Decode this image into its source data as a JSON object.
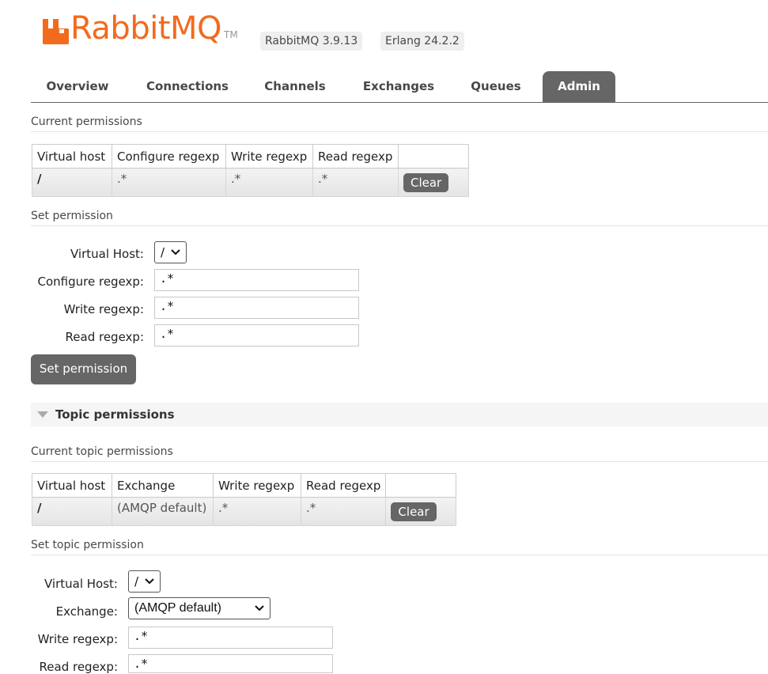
{
  "header": {
    "logo_text": "RabbitMQ",
    "logo_tm": "TM",
    "rabbitmq_version": "RabbitMQ 3.9.13",
    "erlang_version": "Erlang 24.2.2",
    "brand_color": "#f26b1d"
  },
  "tabs": [
    {
      "label": "Overview"
    },
    {
      "label": "Connections"
    },
    {
      "label": "Channels"
    },
    {
      "label": "Exchanges"
    },
    {
      "label": "Queues"
    },
    {
      "label": "Admin",
      "active": true
    }
  ],
  "current_permissions": {
    "title": "Current permissions",
    "columns": [
      "Virtual host",
      "Configure regexp",
      "Write regexp",
      "Read regexp"
    ],
    "rows": [
      {
        "vhost": "/",
        "configure": ".*",
        "write": ".*",
        "read": ".*",
        "action": "Clear"
      }
    ]
  },
  "set_permission": {
    "title": "Set permission",
    "vhost_label": "Virtual Host:",
    "vhost_value": "/",
    "configure_label": "Configure regexp:",
    "configure_value": ".*",
    "write_label": "Write regexp:",
    "write_value": ".*",
    "read_label": "Read regexp:",
    "read_value": ".*",
    "submit_label": "Set permission"
  },
  "topic_permissions": {
    "heading": "Topic permissions",
    "current_title": "Current topic permissions",
    "columns": [
      "Virtual host",
      "Exchange",
      "Write regexp",
      "Read regexp"
    ],
    "rows": [
      {
        "vhost": "/",
        "exchange": "(AMQP default)",
        "write": ".*",
        "read": ".*",
        "action": "Clear"
      }
    ]
  },
  "set_topic_permission": {
    "title": "Set topic permission",
    "vhost_label": "Virtual Host:",
    "vhost_value": "/",
    "exchange_label": "Exchange:",
    "exchange_value": "(AMQP default)",
    "write_label": "Write regexp:",
    "write_value": ".*",
    "read_label": "Read regexp:",
    "read_value": ".*"
  }
}
